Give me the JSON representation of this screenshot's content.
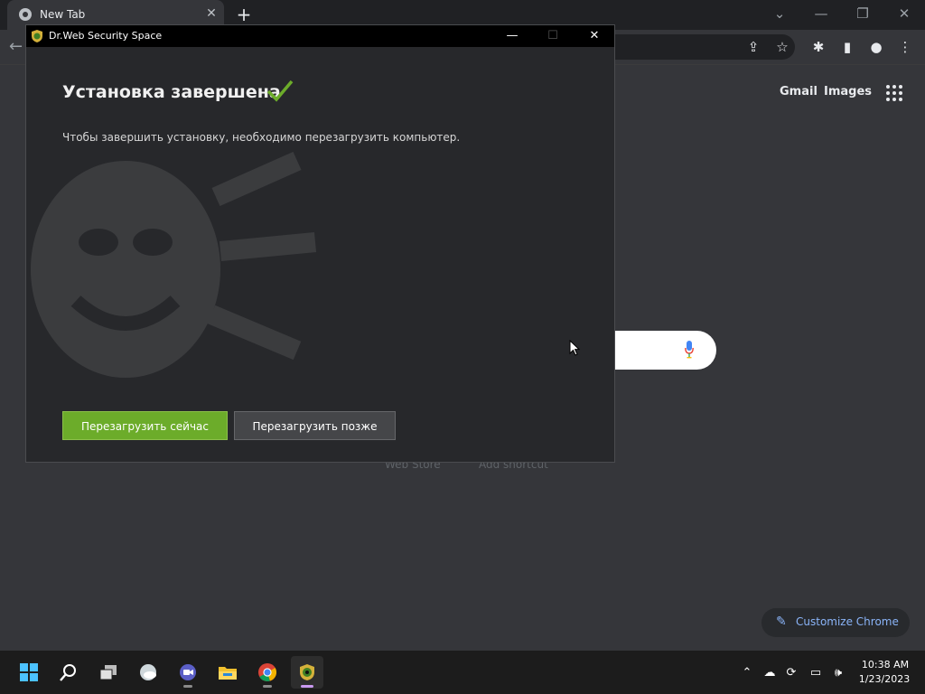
{
  "browser": {
    "tab_title": "New Tab",
    "links": {
      "gmail": "Gmail",
      "images": "Images"
    },
    "shortcuts": [
      "Web Store",
      "Add shortcut"
    ],
    "customize_label": "Customize Chrome"
  },
  "dialog": {
    "title": "Dr.Web Security Space",
    "heading": "Установка завершена",
    "message": "Чтобы завершить установку, необходимо перезагрузить компьютер.",
    "restart_now_label": "Перезагрузить сейчас",
    "restart_later_label": "Перезагрузить позже"
  },
  "taskbar": {
    "apps": [
      "start-icon",
      "search-icon",
      "task-view-icon",
      "widgets-icon",
      "teams-chat-icon",
      "file-explorer-icon",
      "chrome-icon",
      "drweb-installer-icon"
    ],
    "clock": {
      "time": "10:38 AM",
      "date": "1/23/2023"
    }
  },
  "colors": {
    "accent_green": "#6cac2a",
    "chrome_link_blue": "#8ab4f8",
    "dialog_bg": "#27282b"
  }
}
